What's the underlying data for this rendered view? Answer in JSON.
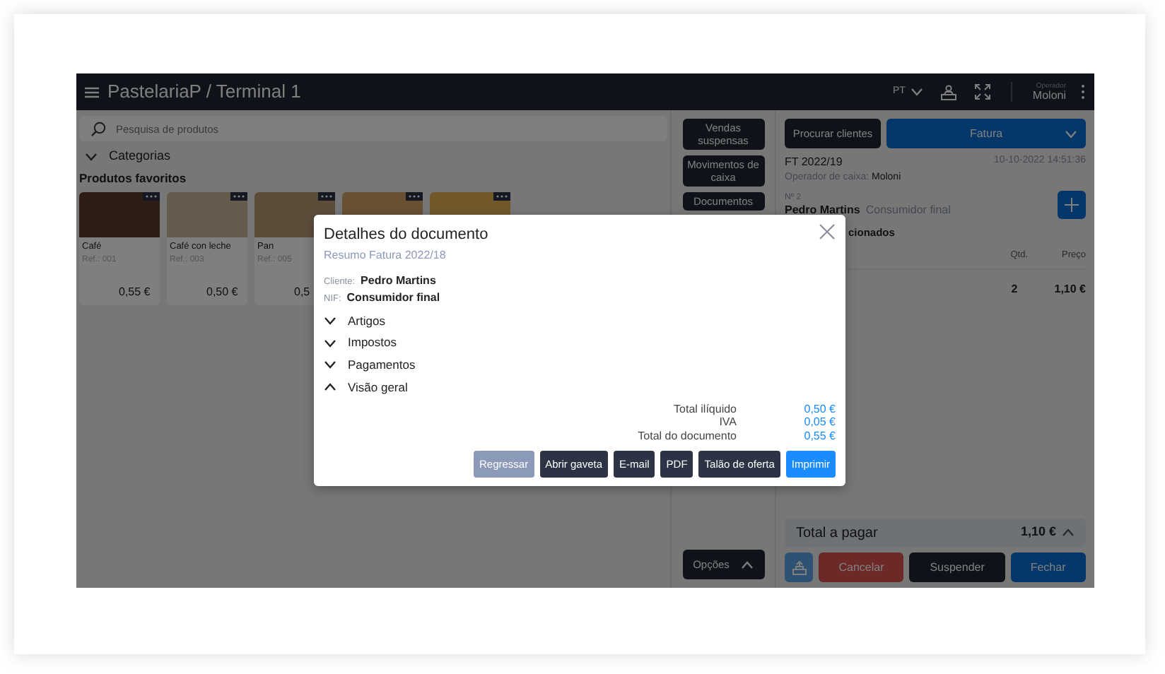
{
  "header": {
    "title": "PastelariaP / Terminal 1",
    "language": "PT",
    "operator_label": "Operador",
    "operator": "Moloni"
  },
  "search": {
    "placeholder": "Pesquisa de produtos"
  },
  "categories": {
    "label": "Categorias",
    "expanded": false
  },
  "favorites_title": "Produtos favoritos",
  "products": [
    {
      "kind": "full",
      "name": "Café",
      "ref": "Ref.: 001",
      "price": "0,55 €"
    },
    {
      "kind": "full",
      "name": "Café con leche",
      "ref": "Ref.: 003",
      "price": "0,50 €"
    },
    {
      "kind": "full",
      "name": "Pan",
      "ref": "Ref.: 005",
      "price": "0,5"
    },
    {
      "kind": "image"
    },
    {
      "kind": "image"
    }
  ],
  "side_buttons": [
    "Vendas suspensas",
    "Movimentos de caixa",
    "Documentos"
  ],
  "options_button": "Opções",
  "customer_button": "Procurar clientes",
  "doc_type": "Fatura",
  "document": {
    "number": "FT 2022/19",
    "date": "10-10-2022 14:51:36",
    "operator_label": "Operador de caixa:",
    "operator": "Moloni",
    "client_no": "Nº 2",
    "client_name": "Pedro Martins",
    "client_nif": "Consumidor final"
  },
  "items_title": "cionados",
  "columns": [
    "Qtd.",
    "Preço"
  ],
  "items": [
    {
      "qty": "2",
      "price": "1,10 €"
    }
  ],
  "total": {
    "label": "Total a pagar",
    "value": "1,10 €",
    "expanded": false
  },
  "actions": [
    {
      "kind": "danger",
      "label": "Cancelar"
    },
    {
      "kind": "dark",
      "label": "Suspender"
    },
    {
      "kind": "primary",
      "label": "Fechar"
    }
  ],
  "modal": {
    "title": "Detalhes do documento",
    "subtitle": "Resumo Fatura 2022/18",
    "client_label": "Cliente:",
    "client": "Pedro Martins",
    "nif_label": "NIF:",
    "nif": "Consumidor final",
    "sections": [
      {
        "label": "Artigos",
        "expanded": false
      },
      {
        "label": "Impostos",
        "expanded": false
      },
      {
        "label": "Pagamentos",
        "expanded": false
      },
      {
        "label": "Visão geral",
        "expanded": true
      }
    ],
    "totals": [
      {
        "label": "Total ilíquido",
        "value": "0,50 €"
      },
      {
        "label": "IVA",
        "value": "0,05 €"
      },
      {
        "label": "Total do documento",
        "value": "0,55 €"
      }
    ],
    "buttons": [
      {
        "kind": "muted",
        "label": "Regressar"
      },
      {
        "kind": "dark",
        "label": "Abrir gaveta"
      },
      {
        "kind": "dark",
        "label": "E-mail"
      },
      {
        "kind": "dark",
        "label": "PDF"
      },
      {
        "kind": "dark",
        "label": "Talão de oferta"
      },
      {
        "kind": "primary",
        "label": "Imprimir"
      }
    ]
  }
}
